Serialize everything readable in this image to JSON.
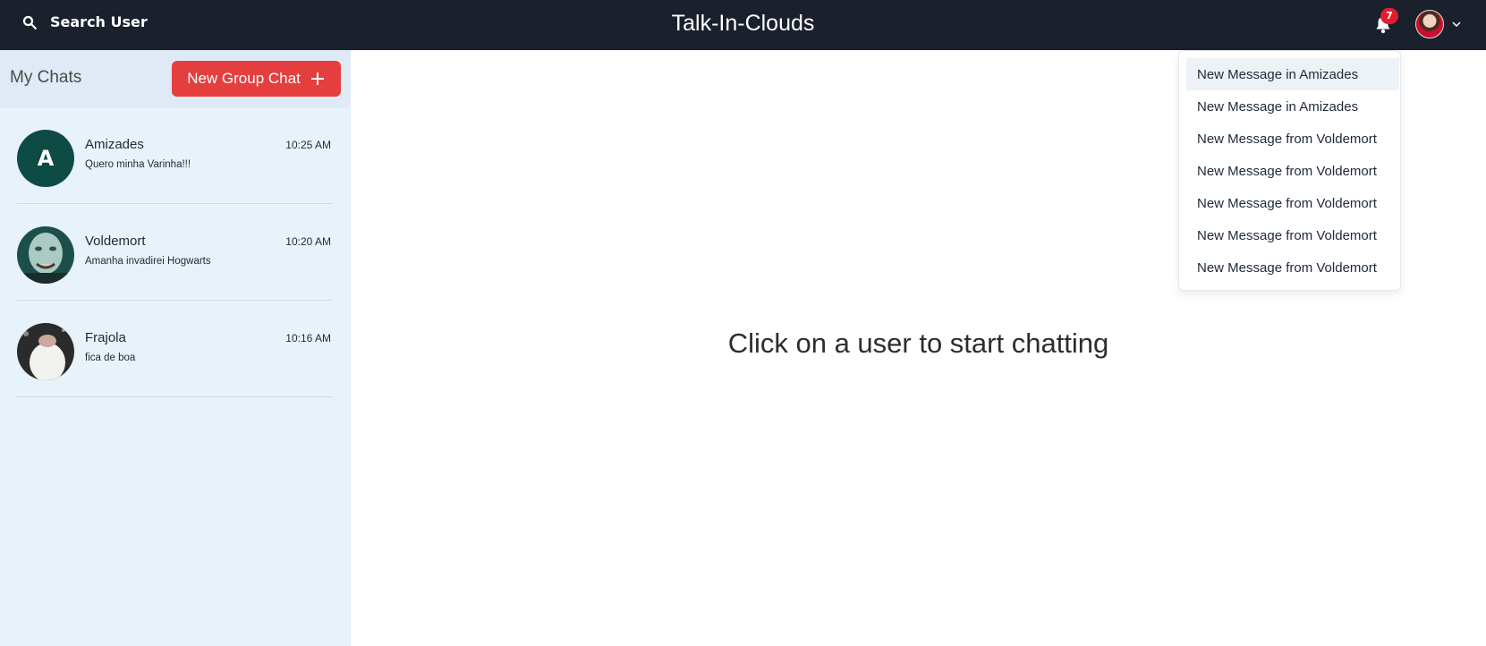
{
  "header": {
    "search_label": "Search User",
    "brand": "Talk-In-Clouds",
    "notification_count": "7",
    "icons": [
      "search-icon",
      "bell-icon",
      "chevron-down-icon"
    ]
  },
  "sidebar": {
    "title": "My Chats",
    "new_group_label": "New Group Chat",
    "chats": [
      {
        "name": "Amizades",
        "message": "Quero minha Varinha!!!",
        "time": "10:25 AM",
        "avatar_letter": "A"
      },
      {
        "name": "Voldemort",
        "message": "Amanha invadirei Hogwarts",
        "time": "10:20 AM"
      },
      {
        "name": "Frajola",
        "message": "fica de boa",
        "time": "10:16 AM"
      }
    ]
  },
  "main": {
    "placeholder": "Click on a user to start chatting"
  },
  "notifications": {
    "items": [
      "New Message in Amizades",
      "New Message in Amizades",
      "New Message from Voldemort",
      "New Message from Voldemort",
      "New Message from Voldemort",
      "New Message from Voldemort",
      "New Message from Voldemort"
    ]
  },
  "colors": {
    "topbar": "#1a202c",
    "accent": "#e53e3e",
    "sidebar": "#e8f2fb",
    "group_avatar": "#0e4b44"
  }
}
